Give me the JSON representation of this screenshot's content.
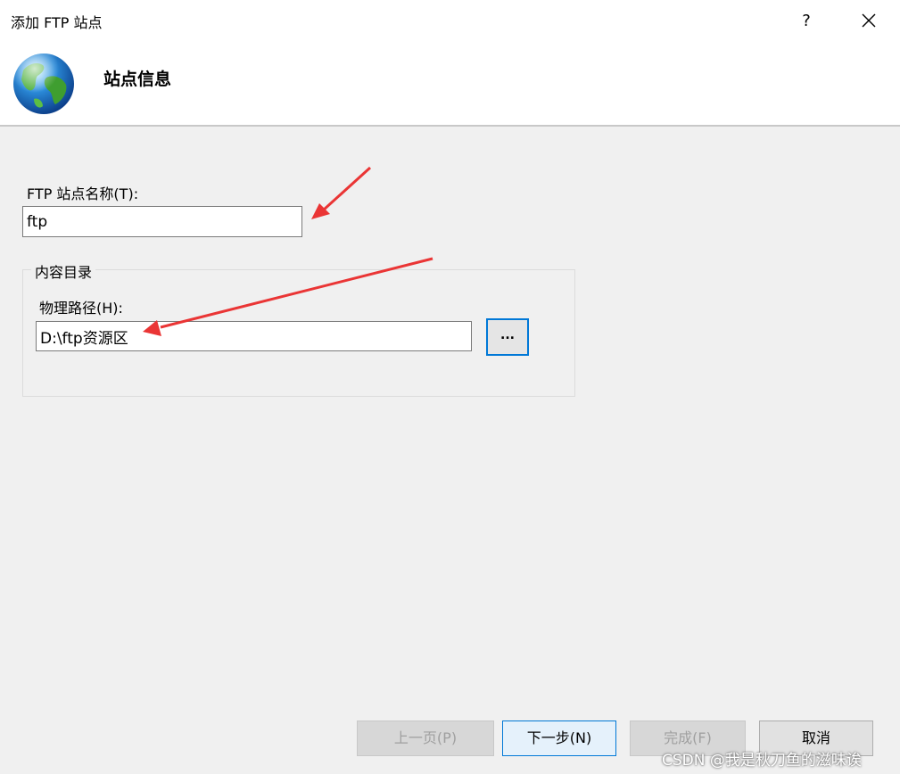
{
  "window": {
    "title": "添加 FTP 站点",
    "help_label": "?",
    "close_icon": "close-icon"
  },
  "header": {
    "heading": "站点信息",
    "icon": "globe-icon"
  },
  "form": {
    "site_name_label": "FTP 站点名称(T):",
    "site_name_value": "ftp",
    "content_directory_group": "内容目录",
    "physical_path_label": "物理路径(H):",
    "physical_path_value": "D:\\ftp资源区",
    "browse_label": "..."
  },
  "footer": {
    "previous_label": "上一页(P)",
    "next_label": "下一步(N)",
    "finish_label": "完成(F)",
    "cancel_label": "取消"
  },
  "watermark": "CSDN @我是秋刀鱼的滋味诶",
  "colors": {
    "focus_border": "#0078d7",
    "annotation_arrow": "#ea3535"
  }
}
